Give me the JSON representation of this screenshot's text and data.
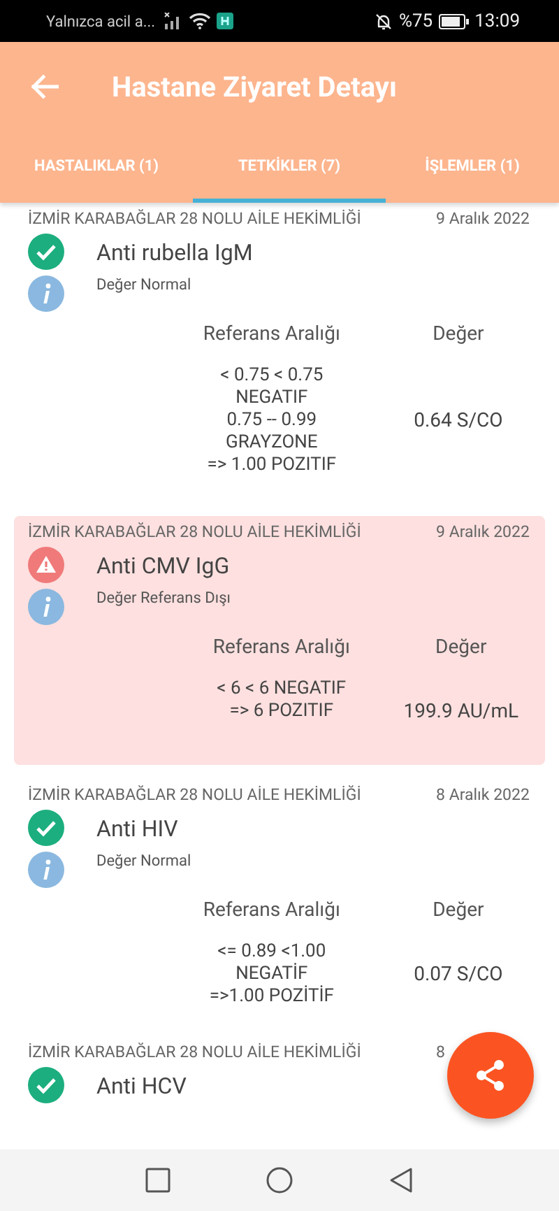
{
  "status_bar": {
    "carrier": "Yalnızca acil a...",
    "battery": "%75",
    "time": "13:09"
  },
  "header": {
    "title": "Hastane Ziyaret Detayı"
  },
  "tabs": [
    {
      "label": "HASTALIKLAR (1)",
      "selected": false
    },
    {
      "label": "TETKİKLER (7)",
      "selected": true
    },
    {
      "label": "İŞLEMLER (1)",
      "selected": false
    }
  ],
  "tests": [
    {
      "kind": "normal",
      "facility": "İZMİR KARABAĞLAR 28 NOLU AİLE HEKİMLİĞİ",
      "date": "9 Aralık 2022",
      "name": "Anti rubella IgM",
      "note": "Değer Normal",
      "range_heading": "Referans Aralığı",
      "value_heading": "Değer",
      "range": "< 0.75 < 0.75\nNEGATIF\n0.75 -- 0.99\nGRAYZONE\n=> 1.00 POZITIF",
      "value": "0.64 S/CO"
    },
    {
      "kind": "abnormal",
      "facility": "İZMİR KARABAĞLAR 28 NOLU AİLE HEKİMLİĞİ",
      "date": "9 Aralık 2022",
      "name": "Anti CMV IgG",
      "note": "Değer Referans Dışı",
      "range_heading": "Referans Aralığı",
      "value_heading": "Değer",
      "range": "< 6 < 6 NEGATIF\n=> 6 POZITIF",
      "value": "199.9 AU/mL"
    },
    {
      "kind": "normal",
      "facility": "İZMİR KARABAĞLAR 28 NOLU AİLE HEKİMLİĞİ",
      "date": "8 Aralık 2022",
      "name": "Anti HIV",
      "note": "Değer Normal",
      "range_heading": "Referans Aralığı",
      "value_heading": "Değer",
      "range": "<= 0.89 <1.00\nNEGATİF\n=>1.00 POZİTİF",
      "value": "0.07 S/CO"
    },
    {
      "kind": "normal",
      "facility": "İZMİR KARABAĞLAR 28 NOLU AİLE HEKİMLİĞİ",
      "date": "8",
      "name": "Anti HCV"
    }
  ]
}
